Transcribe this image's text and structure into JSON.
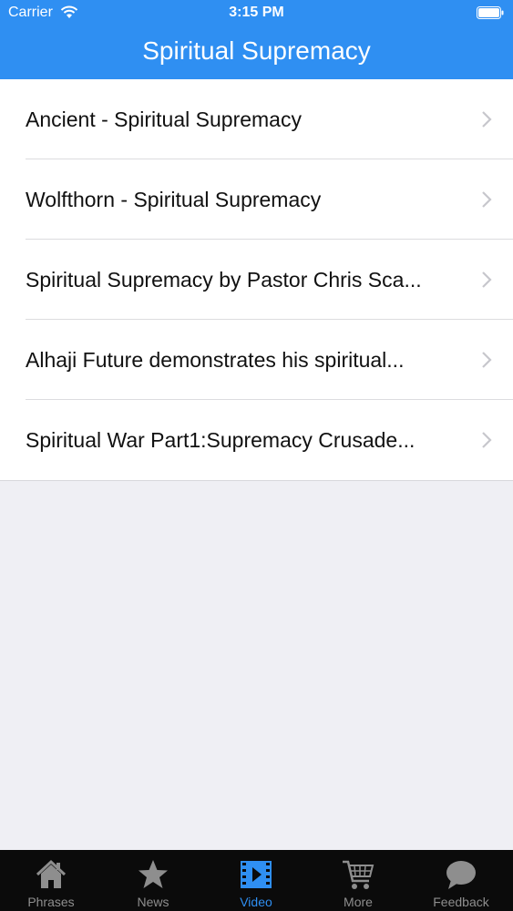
{
  "status_bar": {
    "carrier": "Carrier",
    "time": "3:15 PM"
  },
  "nav": {
    "title": "Spiritual Supremacy"
  },
  "list": {
    "items": [
      {
        "label": "Ancient - Spiritual Supremacy"
      },
      {
        "label": "Wolfthorn - Spiritual Supremacy"
      },
      {
        "label": "Spiritual Supremacy by Pastor Chris Sca..."
      },
      {
        "label": "Alhaji Future demonstrates his spiritual..."
      },
      {
        "label": "Spiritual War Part1:Supremacy Crusade..."
      }
    ]
  },
  "tabs": [
    {
      "label": "Phrases",
      "icon": "house-icon"
    },
    {
      "label": "News",
      "icon": "star-icon"
    },
    {
      "label": "Video",
      "icon": "film-icon",
      "active": true
    },
    {
      "label": "More",
      "icon": "cart-icon"
    },
    {
      "label": "Feedback",
      "icon": "chat-bubble-icon"
    }
  ],
  "colors": {
    "accent": "#2f8ff2",
    "tabbar": "#0b0b0b",
    "background": "#efeff4"
  }
}
